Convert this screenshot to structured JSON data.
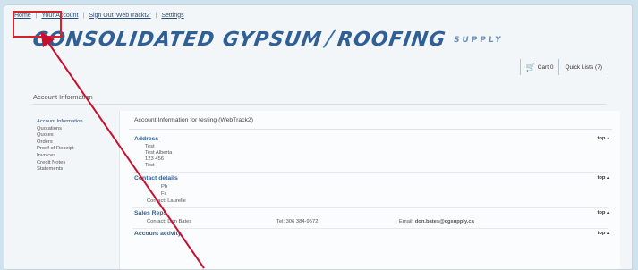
{
  "nav": {
    "home": "Home",
    "your_account": "Your Account",
    "sign_out": "Sign Out 'WebTrackt2'",
    "settings": "Settings"
  },
  "logo": {
    "text": "CONSOLIDATED GYPSUM",
    "slash": "/",
    "text2": "ROOFING",
    "supply": "SUPPLY"
  },
  "cart": {
    "cart_label": "Cart 0",
    "quick_lists": "Quick Lists (7)"
  },
  "page_heading": "Account Information",
  "sidebar": {
    "items": [
      "Account Information",
      "Quotations",
      "Quotes",
      "Orders",
      "Proof of Receipt",
      "Invoices",
      "Credit Notes",
      "Statements"
    ]
  },
  "main": {
    "title": "Account Information for testing (WebTrack2)",
    "top_label": "top",
    "address": {
      "title": "Address",
      "lines": [
        "Test",
        "Test Alberta",
        "123 456",
        "Test"
      ]
    },
    "contact": {
      "title": "Contact details",
      "lines": [
        "Ph",
        "Fx",
        "Contact:   Laurelle"
      ]
    },
    "sales_rep": {
      "title": "Sales Reps",
      "contact_label": "Contact: Don Bates",
      "tel": "Tel: 306 384-9572",
      "email_label": "Email:",
      "email": "don.bates@cgsupply.ca"
    },
    "activity": {
      "title": "Account activity"
    }
  },
  "colors": {
    "highlight": "#d8212a",
    "arrow": "#c8102e",
    "brand": "#2f5f95"
  }
}
